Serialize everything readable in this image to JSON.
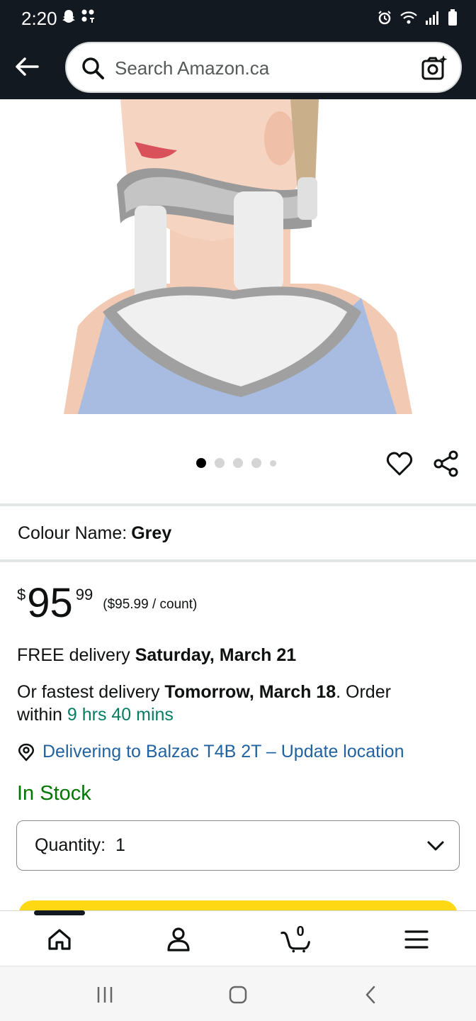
{
  "status_bar": {
    "time": "2:20",
    "left_icons": [
      "snapchat-icon",
      "notification-dots-icon"
    ],
    "right_icons": [
      "alarm-icon",
      "wifi-icon",
      "signal-icon",
      "battery-icon"
    ]
  },
  "header": {
    "back_icon": "arrow-left-icon",
    "search": {
      "placeholder": "Search Amazon.ca",
      "icon": "search-icon",
      "camera_icon": "camera-sparkle-icon"
    }
  },
  "carousel": {
    "image_alt": "Cervical neck traction device",
    "dot_count": 5,
    "active_index": 0,
    "actions": [
      "heart-icon",
      "share-icon"
    ]
  },
  "product": {
    "colour_label": "Colour Name:",
    "colour_value": "Grey",
    "price": {
      "symbol": "$",
      "whole": "95",
      "fraction": "99",
      "unit_price": "($95.99 / count)"
    },
    "delivery": {
      "free_prefix": "FREE delivery ",
      "free_date": "Saturday, March 21",
      "fastest_prefix": "Or fastest delivery ",
      "fastest_date": "Tomorrow, March 18",
      "order_suffix": ". Order",
      "within_label": "within ",
      "within_time": "9 hrs 40 mins"
    },
    "location": "Delivering to Balzac T4B 2T – Update location",
    "stock_status": "In Stock",
    "quantity_label": "Quantity:",
    "quantity_value": "1"
  },
  "bottom_nav": {
    "items": [
      "home-icon",
      "account-icon",
      "cart-icon",
      "menu-icon"
    ],
    "cart_count": "0"
  },
  "system_nav": [
    "recents-icon",
    "home-button-icon",
    "back-chevron-icon"
  ],
  "colors": {
    "header_bg": "#131921",
    "link": "#2162a1",
    "in_stock": "#007600",
    "timer": "#067d62",
    "buy_button": "#ffd814"
  }
}
